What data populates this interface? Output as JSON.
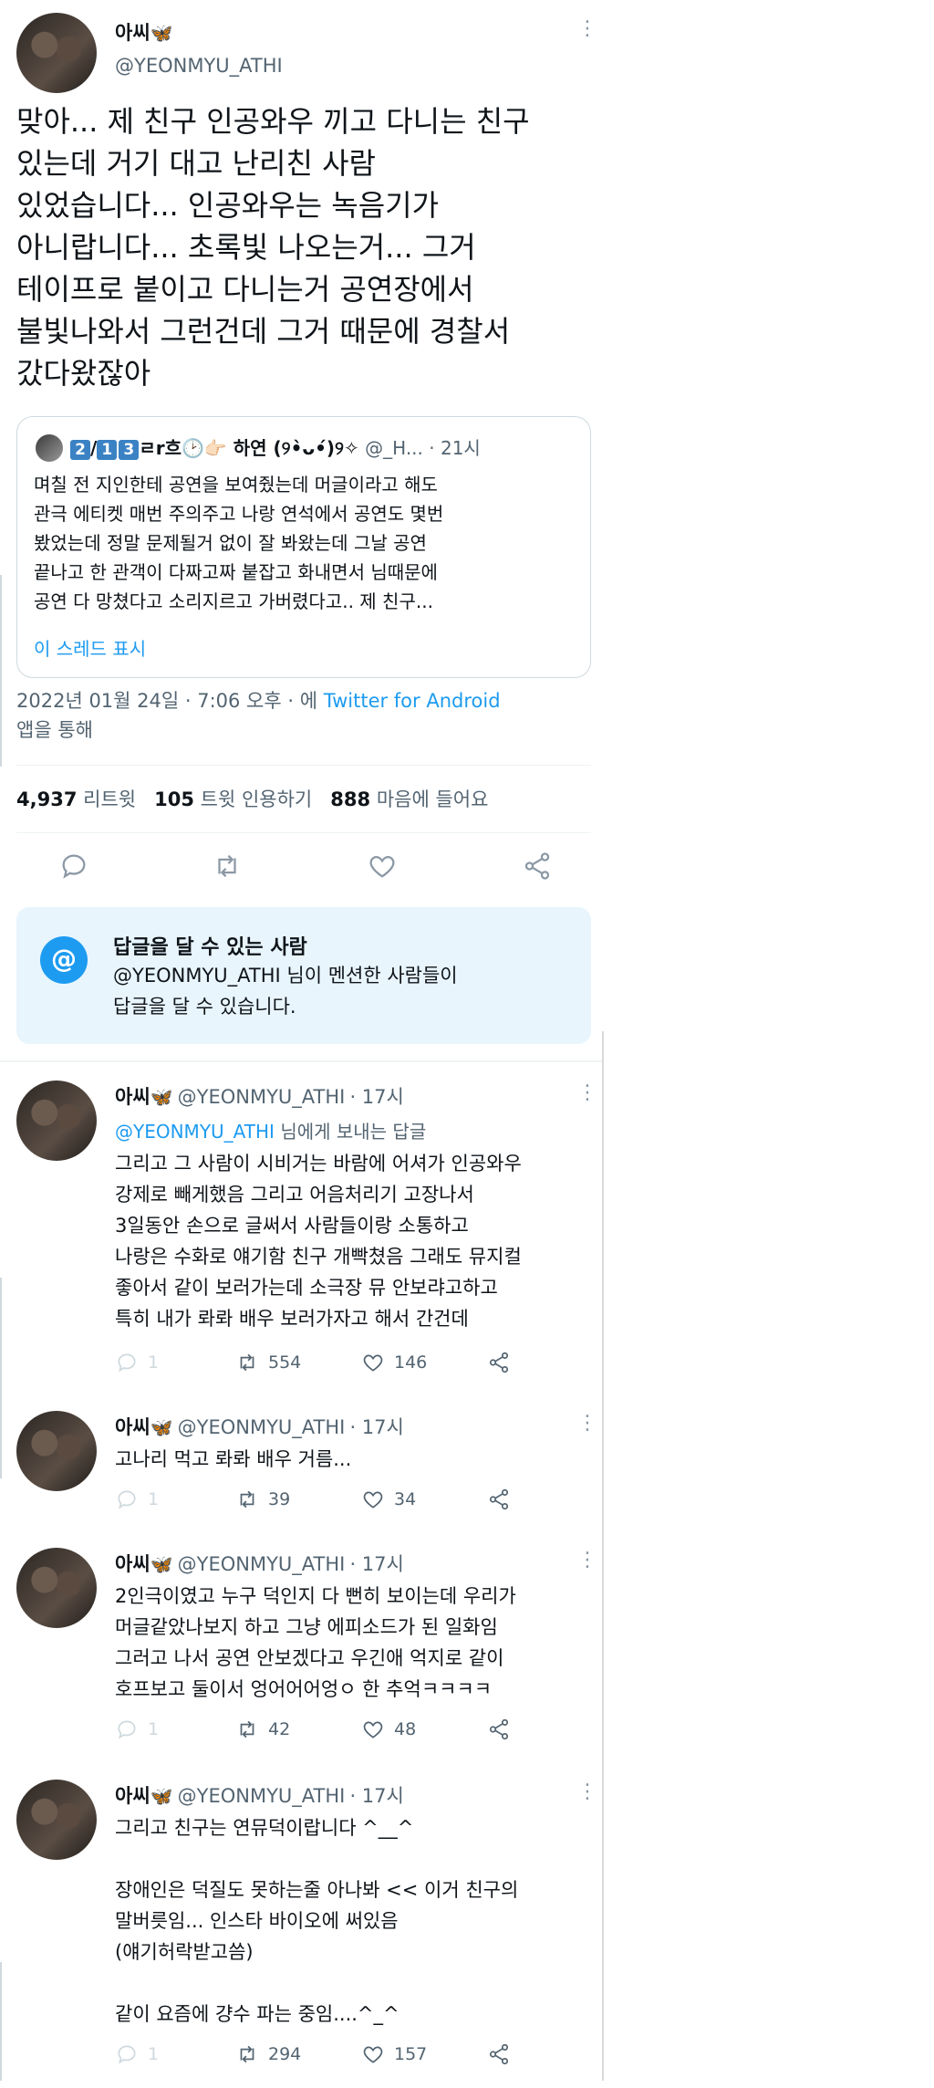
{
  "main": {
    "display_name": "아씨",
    "handle": "@YEONMYU_ATHI",
    "text": "맞아... 제 친구 인공와우 끼고 다니는 친구\n있는데 거기 대고 난리친 사람\n있었습니다... 인공와우는 녹음기가\n아니랍니다... 초록빛 나오는거... 그거\n테이프로 붙이고 다니는거 공연장에서\n불빛나와서 그런건데 그거 때문에 경찰서\n갔다왔잖아"
  },
  "quote": {
    "num1": "2",
    "slash": "/",
    "num2": "1",
    "num3": "3",
    "name_rest": "ㄹr흐🕑👉🏻 하연 (୨•̀ᴗ•́)୨✧",
    "handle": "@_H...",
    "time": "· 21시",
    "text": "며칠 전 지인한테 공연을 보여줬는데 머글이라고 해도\n관극 에티켓 매번 주의주고 나랑 연석에서 공연도 몇번\n봤었는데 정말 문제될거 없이 잘 봐왔는데 그날 공연\n끝나고 한 관객이 다짜고짜 붙잡고 화내면서 님때문에\n공연 다 망쳤다고 소리지르고 가버렸다고.. 제 친구...",
    "show_thread": "이 스레드 표시"
  },
  "meta": {
    "date": "2022년 01월 24일 · 7:06 오후 · 에",
    "source": "Twitter for Android",
    "suffix": "앱을 통해"
  },
  "stats": {
    "retweets": "4,937",
    "retweets_label": "리트윗",
    "quotes": "105",
    "quotes_label": "트윗 인용하기",
    "likes": "888",
    "likes_label": "마음에 들어요"
  },
  "reply_box": {
    "icon": "@",
    "title": "답글을 달 수 있는 사람",
    "body": "@YEONMYU_ATHI 님이 멘션한 사람들이\n답글을 달 수 있습니다."
  },
  "replies": [
    {
      "name": "아씨",
      "handle": "@YEONMYU_ATHI",
      "time": "· 17시",
      "tag_handle": "@YEONMYU_ATHI",
      "tag_suffix": "님에게 보내는 답글",
      "text": "그리고 그 사람이 시비거는 바람에 어셔가 인공와우\n강제로 빼게했음 그리고 어음처리기 고장나서\n3일동안 손으로 글써서 사람들이랑 소통하고\n나랑은 수화로 얘기함 친구 개빡쳤음 그래도 뮤지컬\n좋아서 같이 보러가는데 소극장 뮤 안보랴고하고\n특히 내가 롸롸 배우 보러가자고 해서 간건데",
      "replies": "1",
      "retweets": "554",
      "likes": "146"
    },
    {
      "name": "아씨",
      "handle": "@YEONMYU_ATHI",
      "time": "· 17시",
      "text": "고나리 먹고 롸롸 배우 거름...",
      "replies": "1",
      "retweets": "39",
      "likes": "34"
    },
    {
      "name": "아씨",
      "handle": "@YEONMYU_ATHI",
      "time": "· 17시",
      "text": "2인극이였고 누구 덕인지 다 뻔히 보이는데 우리가\n머글같았나보지 하고 그냥 에피소드가 된 일화임\n그러고 나서 공연 안보겠다고 우긴애 억지로 같이\n호프보고 둘이서 엉어어어엉ㅇ 한 추억ㅋㅋㅋㅋ",
      "replies": "1",
      "retweets": "42",
      "likes": "48"
    },
    {
      "name": "아씨",
      "handle": "@YEONMYU_ATHI",
      "time": "· 17시",
      "text": "그리고 친구는 연뮤덕이랍니다 ^__^\n\n장애인은 덕질도 못하는줄 아나봐 << 이거 친구의\n말버릇임... 인스타 바이오에 써있음\n(얘기허락받고씀)\n\n같이 요즘에 걍수 파는 중임....^_^",
      "replies": "1",
      "retweets": "294",
      "likes": "157"
    }
  ],
  "icons": {
    "butterfly": "🦋",
    "more": "more-vertical-icon",
    "reply": "reply-icon",
    "retweet": "retweet-icon",
    "like": "heart-icon",
    "share": "share-icon",
    "clock": "clock-icon"
  },
  "colors": {
    "link": "#1d9bf0",
    "muted": "#536471",
    "reply_box_bg": "#e8f5fd"
  }
}
